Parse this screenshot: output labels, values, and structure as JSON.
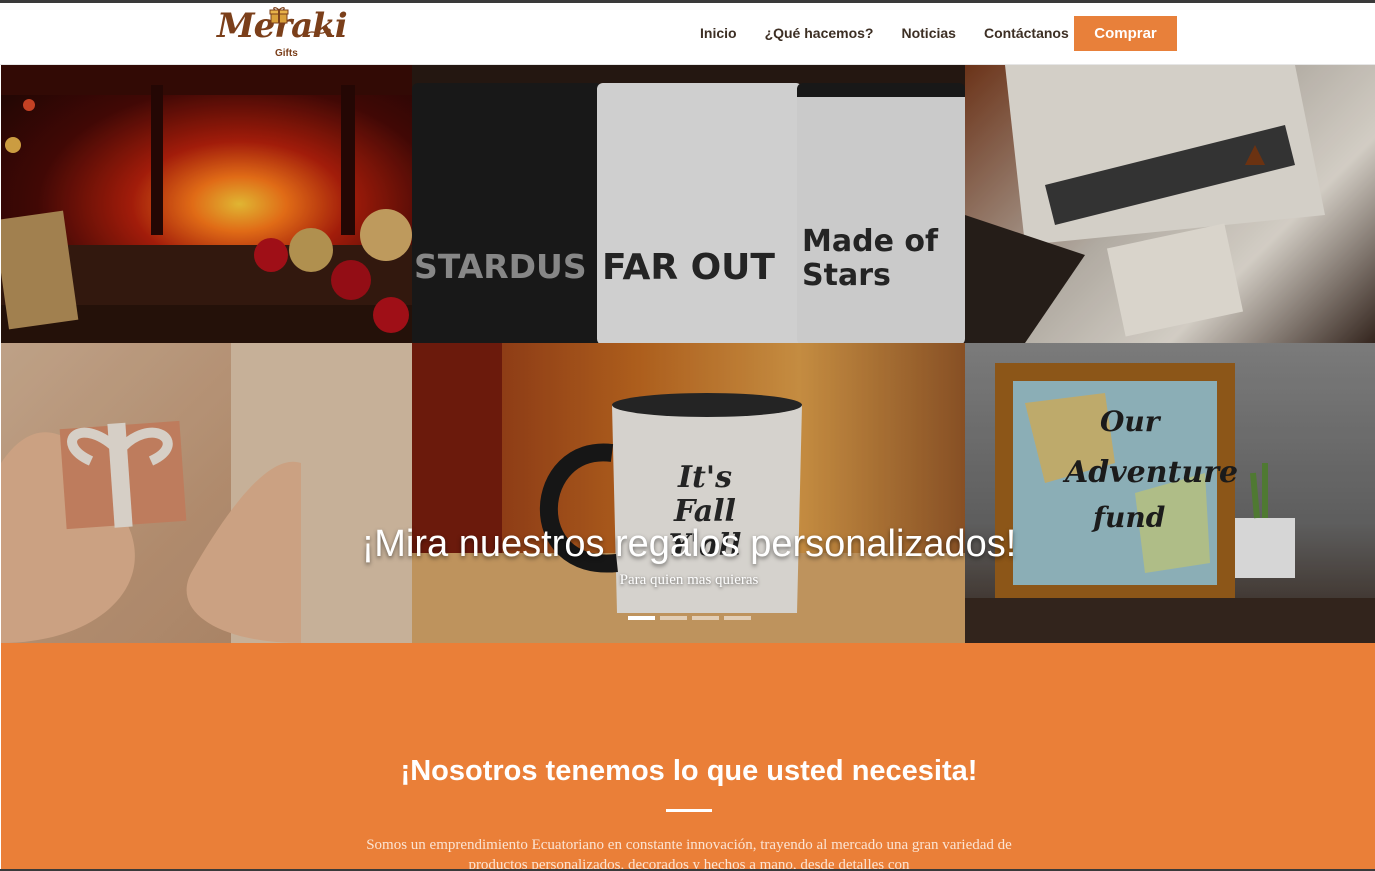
{
  "brand": {
    "logo_word": "Meraki",
    "logo_sub": "Gifts"
  },
  "nav": {
    "items": [
      "Inicio",
      "¿Qué hacemos?",
      "Noticias",
      "Contáctanos"
    ],
    "cta_label": "Comprar"
  },
  "hero": {
    "title": "¡Mira nuestros regalos personalizados!",
    "subtitle": "Para quien mas quieras",
    "slides_count": 4,
    "active_slide": 1,
    "tiles": {
      "shirt_texts": [
        "STARDUS",
        "FAR OUT",
        "Made of Stars"
      ],
      "mug_text": "It's Fall Y'all",
      "frame_text": [
        "Our",
        "Adventure",
        "fund"
      ]
    }
  },
  "about": {
    "title": "¡Nosotros tenemos lo que usted necesita!",
    "text": "Somos un emprendimiento Ecuatoriano en constante innovación, trayendo al mercado una gran variedad de productos personalizados, decorados y hechos a mano, desde detalles con"
  },
  "colors": {
    "accent": "#e8803a",
    "section_bg": "#ea7f38",
    "logo_brown": "#7b3f1a",
    "nav_text": "#3d2f24"
  }
}
